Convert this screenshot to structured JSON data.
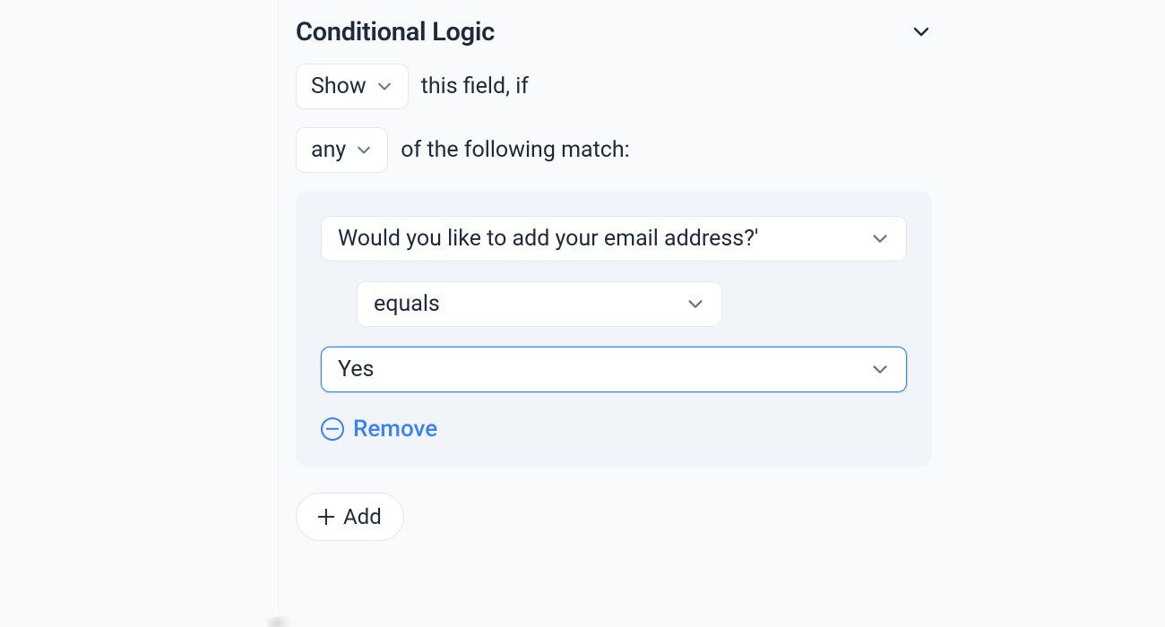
{
  "panel": {
    "title": "Conditional Logic"
  },
  "sentence": {
    "action_select": "Show",
    "action_suffix": "this field, if",
    "match_select": "any",
    "match_suffix": "of the following match:"
  },
  "rule": {
    "field_select": "Would you like to add your email address?'",
    "operator_select": "equals",
    "value_select": "Yes",
    "remove_label": "Remove"
  },
  "add_label": "Add"
}
